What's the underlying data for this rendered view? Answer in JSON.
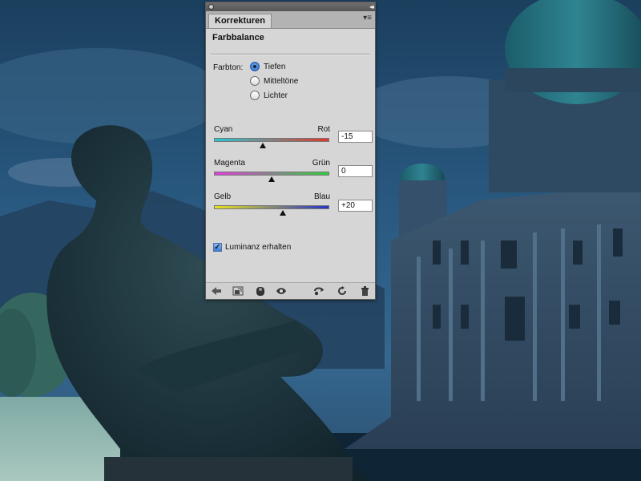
{
  "panel": {
    "tab_label": "Korrekturen",
    "heading": "Farbbalance",
    "tone": {
      "label": "Farbton:",
      "options": [
        "Tiefen",
        "Mitteltöne",
        "Lichter"
      ],
      "selected": "Tiefen"
    },
    "sliders": [
      {
        "left_label": "Cyan",
        "right_label": "Rot",
        "value": "-15",
        "numeric": -15,
        "min": -100,
        "max": 100,
        "gradient": [
          "#28c8d2",
          "#e0392b"
        ]
      },
      {
        "left_label": "Magenta",
        "right_label": "Grün",
        "value": "0",
        "numeric": 0,
        "min": -100,
        "max": 100,
        "gradient": [
          "#e23ddc",
          "#2fcf3a"
        ]
      },
      {
        "left_label": "Gelb",
        "right_label": "Blau",
        "value": "+20",
        "numeric": 20,
        "min": -100,
        "max": 100,
        "gradient": [
          "#e8e21e",
          "#2433c8"
        ]
      }
    ],
    "luminance": {
      "label": "Luminanz erhalten",
      "checked": true
    },
    "footer_icons": [
      "back-arrow-icon",
      "expand-view-icon",
      "clip-to-layer-icon",
      "visibility-eye-icon",
      "previous-state-icon",
      "reset-icon",
      "trash-icon"
    ]
  },
  "colors": {
    "panel_bg": "#d6d6d6",
    "accent": "#3a78d1"
  }
}
